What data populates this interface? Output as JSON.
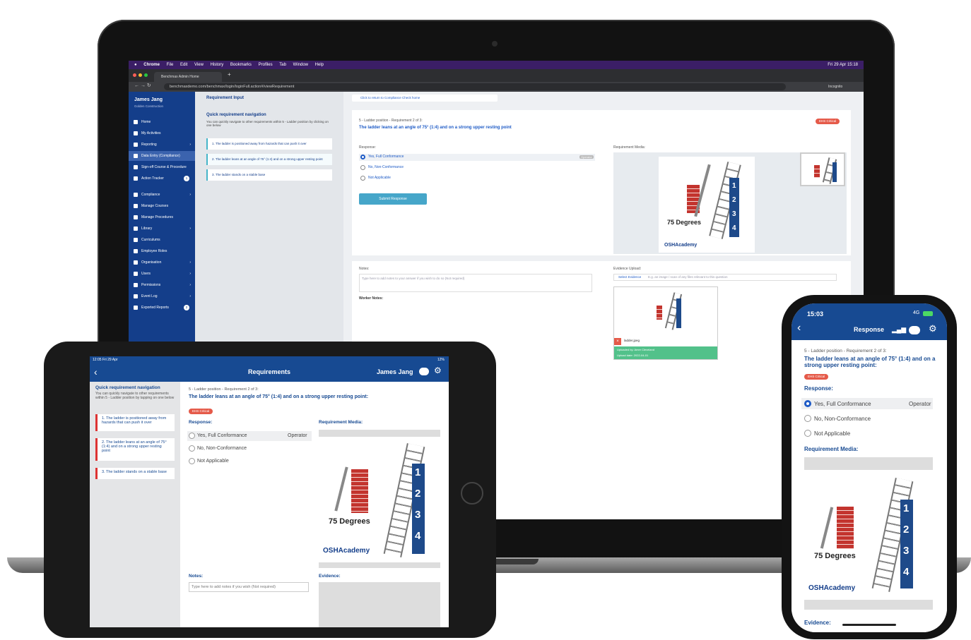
{
  "laptop": {
    "menubar": {
      "items": [
        "Chrome",
        "File",
        "Edit",
        "View",
        "History",
        "Bookmarks",
        "Profiles",
        "Tab",
        "Window",
        "Help"
      ],
      "clock": "Fri 29 Apr 15:18"
    },
    "browser": {
      "tab_title": "Benchmax Admin Home",
      "url": "benchmaxdemo.com/benchmax/login/loginFull.action#/viewRequirement",
      "incognito_label": "Incognito"
    },
    "sidebar": {
      "user_name": "James Jang",
      "org_name": "Golden Construction",
      "items": [
        {
          "label": "Home"
        },
        {
          "label": "My Activities"
        },
        {
          "label": "Reporting"
        },
        {
          "label": "Data Entry (Compliance)"
        },
        {
          "label": "Sign-off Course & Procedure"
        },
        {
          "label": "Action Tracker",
          "badge": "1"
        },
        {
          "label": "Compliance"
        },
        {
          "label": "Manage Courses"
        },
        {
          "label": "Manage Procedures"
        },
        {
          "label": "Library"
        },
        {
          "label": "Curriculums"
        },
        {
          "label": "Employee Roles"
        },
        {
          "label": "Organisation"
        },
        {
          "label": "Users"
        },
        {
          "label": "Permissions"
        },
        {
          "label": "Event Log"
        },
        {
          "label": "Exported Reports",
          "badge": "2"
        }
      ]
    },
    "nav_panel": {
      "page_title": "Requirement Input",
      "heading": "Quick requirement navigation",
      "description": "You can quickly navigate to other requirements within 5 - Ladder position by clicking on one below",
      "steps": [
        "1. The ladder is positioned away from hazards that can push it over",
        "2. The ladder leans at an angle of 75° (1:4) and on a strong upper resting point",
        "3. The ladder stands on a stable base"
      ]
    },
    "main": {
      "return_link": "Click to return to Compliance Check home",
      "breadcrumb": "5 - Ladder position - Requirement 2 of 3:",
      "requirement_title": "The ladder leans at an angle of 75° (1:4) and on a strong upper resting point",
      "ehs_badge": "EHS Critical",
      "response_label": "Response:",
      "options": [
        "Yes, Full Conformance",
        "No, Non-Conformance",
        "Not Applicable"
      ],
      "operator_tag": "Operator",
      "submit_label": "Submit Response",
      "media_label": "Requirement Media:",
      "notes_label": "Notes:",
      "notes_placeholder": "Type here to add notes to your answer if you wish to do so (Not required)",
      "worker_notes_label": "Worker Notes:",
      "evidence_label": "Evidence Upload:",
      "select_evidence": "Select Evidence",
      "evidence_hint": "E.g. an image / scan of any files relevant to this question",
      "file_name": "ladder.jpeg",
      "uploaded_by": "Uploaded by: Amer Cleveland",
      "upload_date": "Upload date: 2022-04-01"
    }
  },
  "illustration": {
    "caption": "75 Degrees",
    "brand": "OSHAcademy",
    "numbers": [
      "1",
      "2",
      "3",
      "4"
    ]
  },
  "tablet": {
    "status_time": "12:05  Fri 29 Apr",
    "battery": "12%",
    "header_title": "Requirements",
    "user_name": "James Jang",
    "nav_heading": "Quick requirement navigation",
    "nav_description": "You can quickly navigate to other requirements within 5 - Ladder position by tapping on one below",
    "steps": [
      "1. The ladder is positioned away from hazards that can push it over",
      "2. The ladder leans at an angle of 75° (1:4) and on a strong upper resting point",
      "3. The ladder stands on a stable base"
    ],
    "breadcrumb": "5 - Ladder position - Requirement 2 of 3:",
    "requirement_title": "The ladder leans at an angle of 75° (1:4) and on a strong upper resting point:",
    "ehs_badge": "EHS Critical",
    "response_label": "Response:",
    "options": [
      "Yes, Full Conformance",
      "No, Non-Conformance",
      "Not Applicable"
    ],
    "operator_tag": "Operator",
    "media_label": "Requirement Media:",
    "notes_label": "Notes:",
    "notes_placeholder": "Type here to add notes if you wish (Not required)",
    "evidence_label": "Evidence:"
  },
  "phone": {
    "status_time": "15:03",
    "network": "4G",
    "header_title": "Response",
    "breadcrumb": "5 - Ladder position - Requirement 2 of 3:",
    "requirement_title": "The ladder leans at an angle of 75° (1:4) and on a strong upper resting point:",
    "ehs_badge": "EHS Critical",
    "response_label": "Response:",
    "options": [
      "Yes, Full Conformance",
      "No, Non-Conformance",
      "Not Applicable"
    ],
    "operator_tag": "Operator",
    "media_label": "Requirement Media:",
    "evidence_label": "Evidence:"
  }
}
